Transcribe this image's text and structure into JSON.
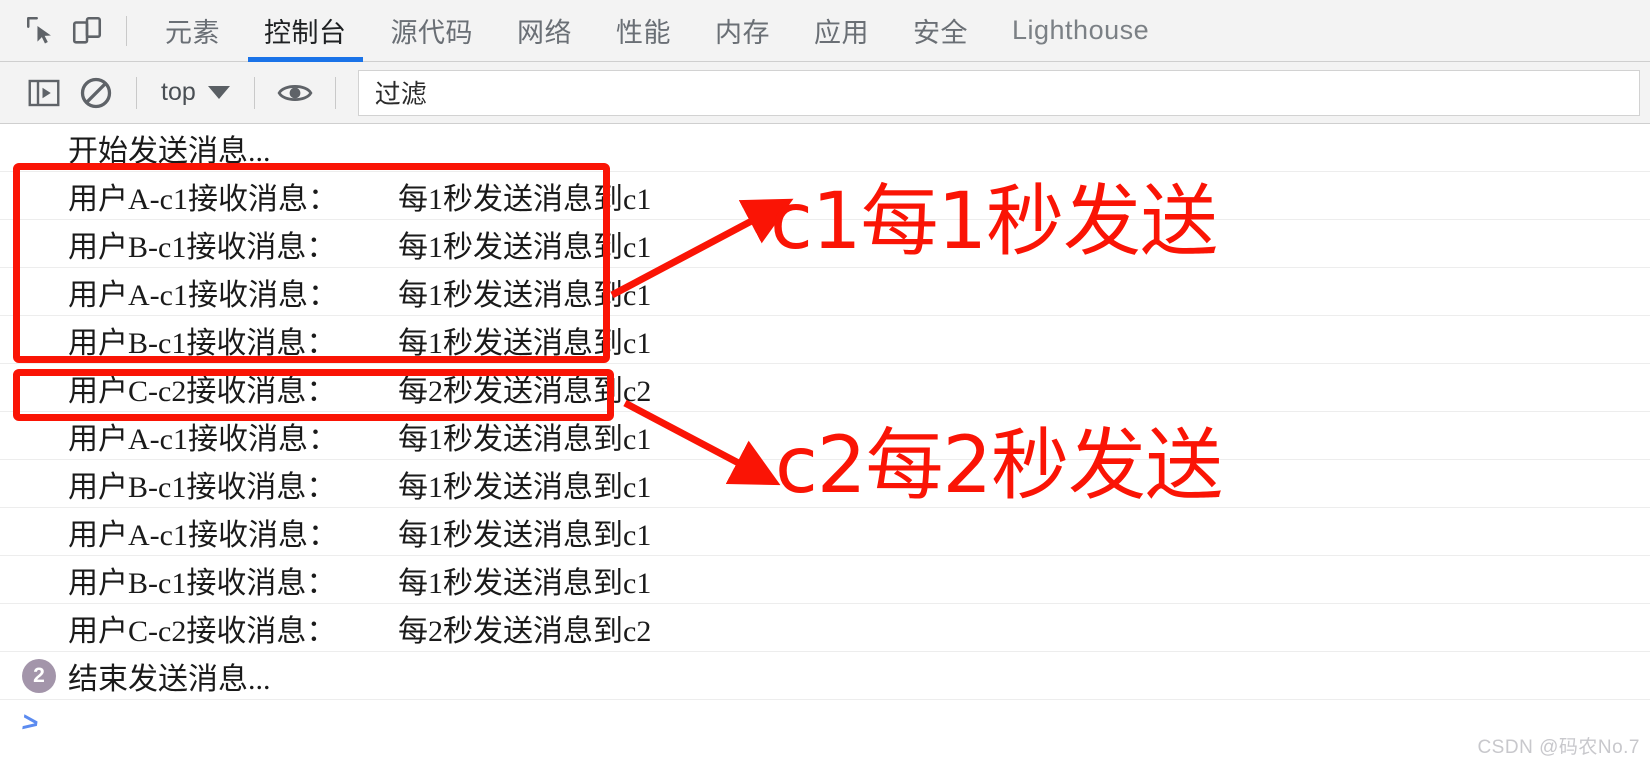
{
  "tabbar": {
    "inspect_icon": "inspect-element-icon",
    "device_icon": "device-toolbar-icon",
    "tabs": [
      {
        "label": "元素",
        "active": false
      },
      {
        "label": "控制台",
        "active": true
      },
      {
        "label": "源代码",
        "active": false
      },
      {
        "label": "网络",
        "active": false
      },
      {
        "label": "性能",
        "active": false
      },
      {
        "label": "内存",
        "active": false
      },
      {
        "label": "应用",
        "active": false
      },
      {
        "label": "安全",
        "active": false
      },
      {
        "label": "Lighthouse",
        "active": false
      }
    ]
  },
  "filterbar": {
    "sidebar_toggle_icon": "console-sidebar-icon",
    "clear_icon": "clear-console-icon",
    "context_value": "top",
    "eye_icon": "live-expression-icon",
    "filter_placeholder": "过滤",
    "filter_value": "过滤"
  },
  "console": {
    "rows": [
      {
        "badge": "",
        "user": "开始发送消息...",
        "body": ""
      },
      {
        "badge": "",
        "user": "用户A-c1接收消息：",
        "body": "每1秒发送消息到c1"
      },
      {
        "badge": "",
        "user": "用户B-c1接收消息：",
        "body": "每1秒发送消息到c1"
      },
      {
        "badge": "",
        "user": "用户A-c1接收消息：",
        "body": "每1秒发送消息到c1"
      },
      {
        "badge": "",
        "user": "用户B-c1接收消息：",
        "body": "每1秒发送消息到c1"
      },
      {
        "badge": "",
        "user": "用户C-c2接收消息：",
        "body": "每2秒发送消息到c2"
      },
      {
        "badge": "",
        "user": "用户A-c1接收消息：",
        "body": "每1秒发送消息到c1"
      },
      {
        "badge": "",
        "user": "用户B-c1接收消息：",
        "body": "每1秒发送消息到c1"
      },
      {
        "badge": "",
        "user": "用户A-c1接收消息：",
        "body": "每1秒发送消息到c1"
      },
      {
        "badge": "",
        "user": "用户B-c1接收消息：",
        "body": "每1秒发送消息到c1"
      },
      {
        "badge": "",
        "user": "用户C-c2接收消息：",
        "body": "每2秒发送消息到c2"
      },
      {
        "badge": "2",
        "user": "结束发送消息...",
        "body": ""
      }
    ],
    "prompt_caret": ">"
  },
  "annotations": {
    "color": "#fa1405",
    "label_1": "c1每1秒发送",
    "label_2": "c2每2秒发送"
  },
  "watermark": "CSDN @码农No.7"
}
